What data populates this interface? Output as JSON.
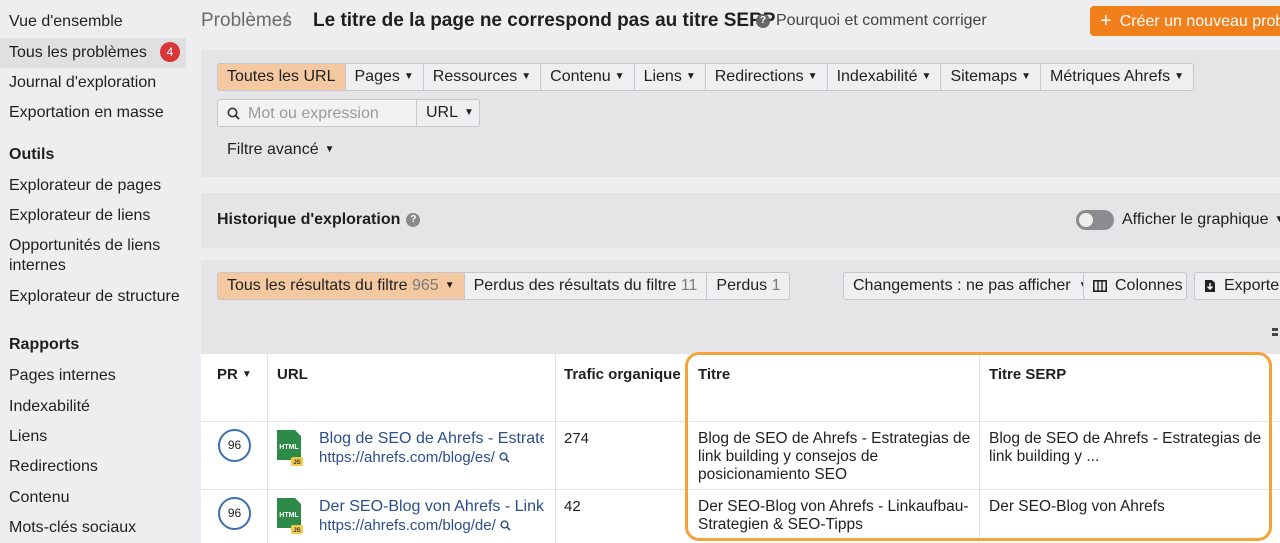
{
  "sidebar": {
    "items": [
      {
        "label": "Vue d'ensemble"
      },
      {
        "label": "Tous les problèmes",
        "badge": "4"
      },
      {
        "label": "Journal d'exploration"
      },
      {
        "label": "Exportation en masse"
      }
    ],
    "tools_heading": "Outils",
    "tools": [
      {
        "label": "Explorateur de pages"
      },
      {
        "label": "Explorateur de liens"
      },
      {
        "label": "Opportunités de liens internes"
      },
      {
        "label": "Explorateur de structure"
      }
    ],
    "reports_heading": "Rapports",
    "reports": [
      {
        "label": "Pages internes"
      },
      {
        "label": "Indexabilité"
      },
      {
        "label": "Liens"
      },
      {
        "label": "Redirections"
      },
      {
        "label": "Contenu"
      },
      {
        "label": "Mots-clés sociaux"
      }
    ]
  },
  "header": {
    "breadcrumb": "Problèmes",
    "separator": "/",
    "title": "Le titre de la page ne correspond pas au titre SERP",
    "help_link": "Pourquoi et comment corriger",
    "create_button": "Créer un nouveau prob."
  },
  "filters": {
    "tabs": [
      {
        "label": "Toutes les URL",
        "active": true,
        "dropdown": false
      },
      {
        "label": "Pages",
        "dropdown": true
      },
      {
        "label": "Ressources",
        "dropdown": true
      },
      {
        "label": "Contenu",
        "dropdown": true
      },
      {
        "label": "Liens",
        "dropdown": true
      },
      {
        "label": "Redirections",
        "dropdown": true
      },
      {
        "label": "Indexabilité",
        "dropdown": true
      },
      {
        "label": "Sitemaps",
        "dropdown": true
      },
      {
        "label": "Métriques Ahrefs",
        "dropdown": true
      }
    ],
    "search_placeholder": "Mot ou expression",
    "search_scope": "URL",
    "advanced": "Filtre avancé"
  },
  "history": {
    "title": "Historique d'exploration",
    "graph_toggle": "Afficher le graphique"
  },
  "results": {
    "tabs": [
      {
        "label": "Tous les résultats du filtre",
        "count": "965",
        "active": true
      },
      {
        "label": "Perdus des résultats du filtre",
        "count": "11"
      },
      {
        "label": "Perdus",
        "count": "1"
      }
    ],
    "changes": "Changements : ne pas afficher",
    "columns": "Colonnes",
    "export": "Exporter"
  },
  "table": {
    "headers": {
      "pr": "PR",
      "url": "URL",
      "traffic": "Trafic organique",
      "title": "Titre",
      "serp_title": "Titre SERP"
    },
    "rows": [
      {
        "pr": "96",
        "file_type": "HTML",
        "file_sub": "JS",
        "page_title": "Blog de SEO de Ahrefs - Estrate...",
        "url": "https://ahrefs.com/blog/es/",
        "traffic": "274",
        "title": "Blog de SEO de Ahrefs - Estrategias de link building y consejos de posicionamiento SEO",
        "serp_title": "Blog de SEO de Ahrefs - Estrategias de link building y ..."
      },
      {
        "pr": "96",
        "file_type": "HTML",
        "file_sub": "JS",
        "page_title": "Der SEO-Blog von Ahrefs - Linka...",
        "url": "https://ahrefs.com/blog/de/",
        "traffic": "42",
        "title": "Der SEO-Blog von Ahrefs - Linkaufbau-Strategien & SEO-Tipps",
        "serp_title": "Der SEO-Blog von Ahrefs"
      }
    ]
  },
  "colors": {
    "accent": "#f07f1c",
    "active_tab": "#f4c9a1",
    "badge": "#d93737",
    "link": "#2b4e8a",
    "highlight": "#f2a33a"
  }
}
